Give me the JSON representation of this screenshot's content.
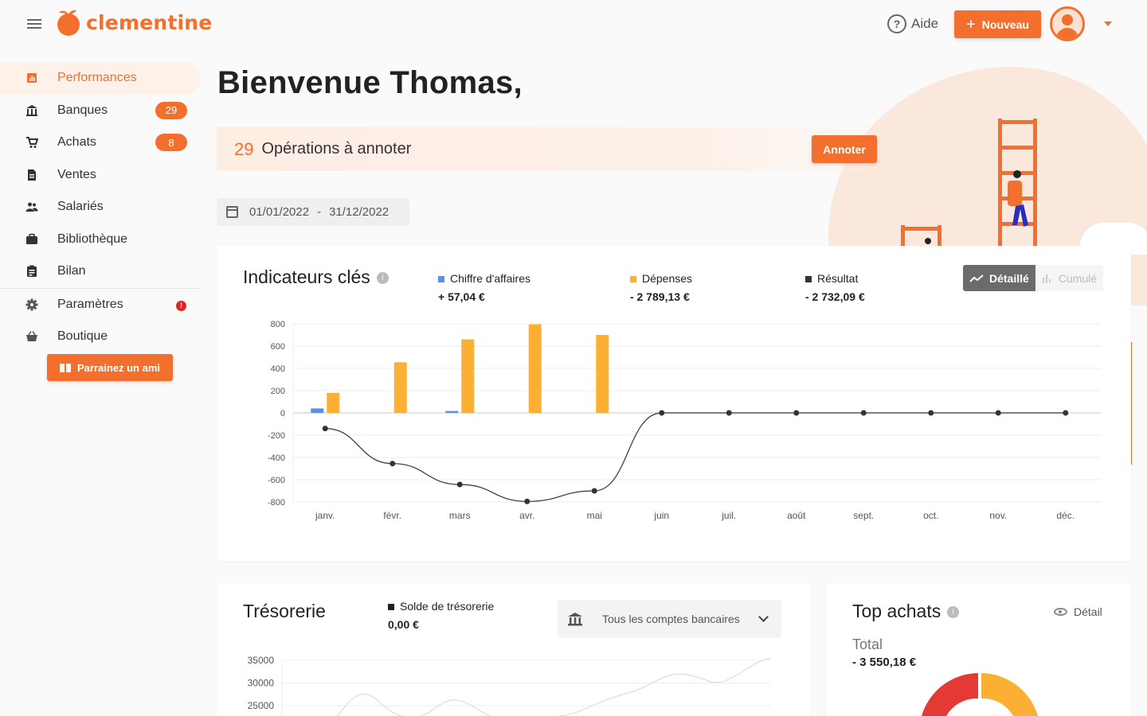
{
  "app": {
    "name": "clementine"
  },
  "header": {
    "help_label": "Aide",
    "new_label": "Nouveau"
  },
  "sidebar": {
    "items": [
      {
        "label": "Performances",
        "icon": "bar-chart-icon",
        "active": true
      },
      {
        "label": "Banques",
        "icon": "bank-icon",
        "badge": "29"
      },
      {
        "label": "Achats",
        "icon": "cart-icon",
        "badge": "8"
      },
      {
        "label": "Ventes",
        "icon": "document-icon"
      },
      {
        "label": "Salariés",
        "icon": "people-icon"
      },
      {
        "label": "Bibliothèque",
        "icon": "briefcase-icon"
      },
      {
        "label": "Bilan",
        "icon": "clipboard-icon"
      },
      {
        "label": "Paramètres",
        "icon": "gear-icon",
        "alert": "!"
      },
      {
        "label": "Boutique",
        "icon": "basket-icon"
      }
    ],
    "refer_label": "Parrainez un ami"
  },
  "main": {
    "greeting": "Bienvenue Thomas,",
    "ops_count": "29",
    "ops_label": "Opérations à annoter",
    "annotate_label": "Annoter",
    "date_start": "01/01/2022",
    "date_sep": "-",
    "date_end": "31/12/2022"
  },
  "kpi": {
    "title": "Indicateurs clés",
    "legend": [
      {
        "label": "Chiffre d'affaires",
        "value": "+ 57,04 €",
        "color": "#5b8ee6"
      },
      {
        "label": "Dépenses",
        "value": "- 2 789,13 €",
        "color": "#fbb034"
      },
      {
        "label": "Résultat",
        "value": "- 2 732,09 €",
        "color": "#333333"
      }
    ],
    "toggle_detail": "Détaillé",
    "toggle_cumul": "Cumulé"
  },
  "chart_data": [
    {
      "type": "bar",
      "categories": [
        "janv.",
        "févr.",
        "mars",
        "avr.",
        "mai",
        "juin",
        "juil.",
        "août",
        "sept.",
        "oct.",
        "nov.",
        "déc."
      ],
      "series": [
        {
          "name": "Chiffre d'affaires",
          "type": "bar",
          "color": "#5b8ee6",
          "values": [
            40,
            0,
            17,
            0,
            0,
            0,
            0,
            0,
            0,
            0,
            0,
            0
          ]
        },
        {
          "name": "Dépenses",
          "type": "bar",
          "color": "#fbb034",
          "values": [
            180,
            455,
            660,
            795,
            700,
            0,
            0,
            0,
            0,
            0,
            0,
            0
          ]
        },
        {
          "name": "Résultat",
          "type": "line",
          "color": "#333333",
          "values": [
            -140,
            -455,
            -643,
            -795,
            -700,
            0,
            0,
            0,
            0,
            0,
            0,
            0
          ]
        }
      ],
      "yticks": [
        "800",
        "600",
        "400",
        "200",
        "0",
        "-200",
        "-400",
        "-600",
        "-800"
      ],
      "ylim": [
        -800,
        800
      ],
      "grid": true
    },
    {
      "type": "line",
      "title": "Trésorerie",
      "series": [
        {
          "name": "Solde de trésorerie",
          "color": "#dddddd"
        }
      ],
      "yticks": [
        "35000",
        "30000",
        "25000"
      ],
      "grid": true
    }
  ],
  "treso": {
    "title": "Trésorerie",
    "legend_label": "Solde de trésorerie",
    "legend_value": "0,00 €",
    "account_select": "Tous les comptes bancaires"
  },
  "top_achats": {
    "title": "Top achats",
    "detail_label": "Détail",
    "total_label": "Total",
    "total_value": "- 3 550,18 €",
    "donut_colors": [
      "#e53935",
      "#fbb034"
    ]
  }
}
